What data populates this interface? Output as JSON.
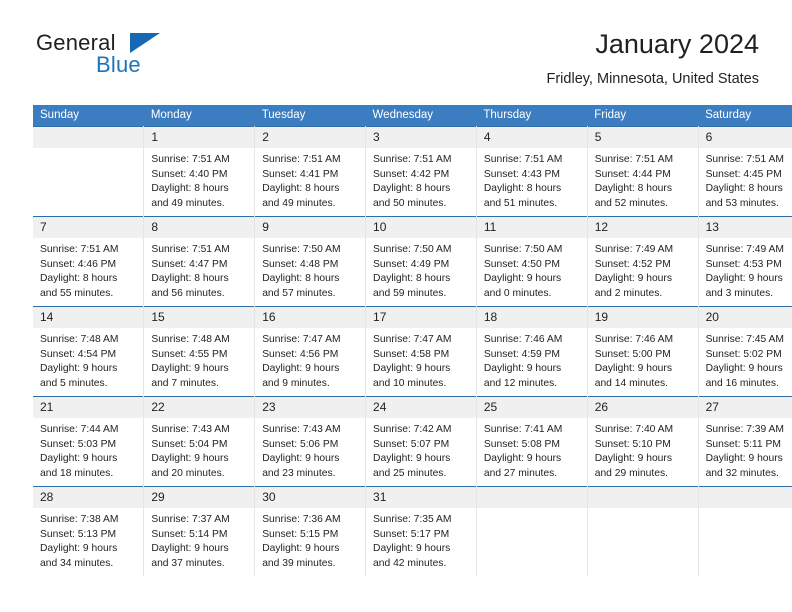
{
  "brand": {
    "name_part1": "General",
    "name_part2": "Blue",
    "triangle_icon": "triangle-icon",
    "accent_color": "#1b75bb"
  },
  "header": {
    "title": "January 2024",
    "subtitle": "Fridley, Minnesota, United States"
  },
  "colors": {
    "header_blue": "#3b7dc0",
    "row_divider": "#2f6ca8",
    "daynum_band": "#f0f0f0",
    "text": "#231f20"
  },
  "weekday_headers": [
    "Sunday",
    "Monday",
    "Tuesday",
    "Wednesday",
    "Thursday",
    "Friday",
    "Saturday"
  ],
  "weeks": [
    [
      {
        "day": "",
        "sunrise": "",
        "sunset": "",
        "daylight_line1": "",
        "daylight_line2": "",
        "empty": true
      },
      {
        "day": "1",
        "sunrise": "Sunrise: 7:51 AM",
        "sunset": "Sunset: 4:40 PM",
        "daylight_line1": "Daylight: 8 hours",
        "daylight_line2": "and 49 minutes."
      },
      {
        "day": "2",
        "sunrise": "Sunrise: 7:51 AM",
        "sunset": "Sunset: 4:41 PM",
        "daylight_line1": "Daylight: 8 hours",
        "daylight_line2": "and 49 minutes."
      },
      {
        "day": "3",
        "sunrise": "Sunrise: 7:51 AM",
        "sunset": "Sunset: 4:42 PM",
        "daylight_line1": "Daylight: 8 hours",
        "daylight_line2": "and 50 minutes."
      },
      {
        "day": "4",
        "sunrise": "Sunrise: 7:51 AM",
        "sunset": "Sunset: 4:43 PM",
        "daylight_line1": "Daylight: 8 hours",
        "daylight_line2": "and 51 minutes."
      },
      {
        "day": "5",
        "sunrise": "Sunrise: 7:51 AM",
        "sunset": "Sunset: 4:44 PM",
        "daylight_line1": "Daylight: 8 hours",
        "daylight_line2": "and 52 minutes."
      },
      {
        "day": "6",
        "sunrise": "Sunrise: 7:51 AM",
        "sunset": "Sunset: 4:45 PM",
        "daylight_line1": "Daylight: 8 hours",
        "daylight_line2": "and 53 minutes."
      }
    ],
    [
      {
        "day": "7",
        "sunrise": "Sunrise: 7:51 AM",
        "sunset": "Sunset: 4:46 PM",
        "daylight_line1": "Daylight: 8 hours",
        "daylight_line2": "and 55 minutes."
      },
      {
        "day": "8",
        "sunrise": "Sunrise: 7:51 AM",
        "sunset": "Sunset: 4:47 PM",
        "daylight_line1": "Daylight: 8 hours",
        "daylight_line2": "and 56 minutes."
      },
      {
        "day": "9",
        "sunrise": "Sunrise: 7:50 AM",
        "sunset": "Sunset: 4:48 PM",
        "daylight_line1": "Daylight: 8 hours",
        "daylight_line2": "and 57 minutes."
      },
      {
        "day": "10",
        "sunrise": "Sunrise: 7:50 AM",
        "sunset": "Sunset: 4:49 PM",
        "daylight_line1": "Daylight: 8 hours",
        "daylight_line2": "and 59 minutes."
      },
      {
        "day": "11",
        "sunrise": "Sunrise: 7:50 AM",
        "sunset": "Sunset: 4:50 PM",
        "daylight_line1": "Daylight: 9 hours",
        "daylight_line2": "and 0 minutes."
      },
      {
        "day": "12",
        "sunrise": "Sunrise: 7:49 AM",
        "sunset": "Sunset: 4:52 PM",
        "daylight_line1": "Daylight: 9 hours",
        "daylight_line2": "and 2 minutes."
      },
      {
        "day": "13",
        "sunrise": "Sunrise: 7:49 AM",
        "sunset": "Sunset: 4:53 PM",
        "daylight_line1": "Daylight: 9 hours",
        "daylight_line2": "and 3 minutes."
      }
    ],
    [
      {
        "day": "14",
        "sunrise": "Sunrise: 7:48 AM",
        "sunset": "Sunset: 4:54 PM",
        "daylight_line1": "Daylight: 9 hours",
        "daylight_line2": "and 5 minutes."
      },
      {
        "day": "15",
        "sunrise": "Sunrise: 7:48 AM",
        "sunset": "Sunset: 4:55 PM",
        "daylight_line1": "Daylight: 9 hours",
        "daylight_line2": "and 7 minutes."
      },
      {
        "day": "16",
        "sunrise": "Sunrise: 7:47 AM",
        "sunset": "Sunset: 4:56 PM",
        "daylight_line1": "Daylight: 9 hours",
        "daylight_line2": "and 9 minutes."
      },
      {
        "day": "17",
        "sunrise": "Sunrise: 7:47 AM",
        "sunset": "Sunset: 4:58 PM",
        "daylight_line1": "Daylight: 9 hours",
        "daylight_line2": "and 10 minutes."
      },
      {
        "day": "18",
        "sunrise": "Sunrise: 7:46 AM",
        "sunset": "Sunset: 4:59 PM",
        "daylight_line1": "Daylight: 9 hours",
        "daylight_line2": "and 12 minutes."
      },
      {
        "day": "19",
        "sunrise": "Sunrise: 7:46 AM",
        "sunset": "Sunset: 5:00 PM",
        "daylight_line1": "Daylight: 9 hours",
        "daylight_line2": "and 14 minutes."
      },
      {
        "day": "20",
        "sunrise": "Sunrise: 7:45 AM",
        "sunset": "Sunset: 5:02 PM",
        "daylight_line1": "Daylight: 9 hours",
        "daylight_line2": "and 16 minutes."
      }
    ],
    [
      {
        "day": "21",
        "sunrise": "Sunrise: 7:44 AM",
        "sunset": "Sunset: 5:03 PM",
        "daylight_line1": "Daylight: 9 hours",
        "daylight_line2": "and 18 minutes."
      },
      {
        "day": "22",
        "sunrise": "Sunrise: 7:43 AM",
        "sunset": "Sunset: 5:04 PM",
        "daylight_line1": "Daylight: 9 hours",
        "daylight_line2": "and 20 minutes."
      },
      {
        "day": "23",
        "sunrise": "Sunrise: 7:43 AM",
        "sunset": "Sunset: 5:06 PM",
        "daylight_line1": "Daylight: 9 hours",
        "daylight_line2": "and 23 minutes."
      },
      {
        "day": "24",
        "sunrise": "Sunrise: 7:42 AM",
        "sunset": "Sunset: 5:07 PM",
        "daylight_line1": "Daylight: 9 hours",
        "daylight_line2": "and 25 minutes."
      },
      {
        "day": "25",
        "sunrise": "Sunrise: 7:41 AM",
        "sunset": "Sunset: 5:08 PM",
        "daylight_line1": "Daylight: 9 hours",
        "daylight_line2": "and 27 minutes."
      },
      {
        "day": "26",
        "sunrise": "Sunrise: 7:40 AM",
        "sunset": "Sunset: 5:10 PM",
        "daylight_line1": "Daylight: 9 hours",
        "daylight_line2": "and 29 minutes."
      },
      {
        "day": "27",
        "sunrise": "Sunrise: 7:39 AM",
        "sunset": "Sunset: 5:11 PM",
        "daylight_line1": "Daylight: 9 hours",
        "daylight_line2": "and 32 minutes."
      }
    ],
    [
      {
        "day": "28",
        "sunrise": "Sunrise: 7:38 AM",
        "sunset": "Sunset: 5:13 PM",
        "daylight_line1": "Daylight: 9 hours",
        "daylight_line2": "and 34 minutes."
      },
      {
        "day": "29",
        "sunrise": "Sunrise: 7:37 AM",
        "sunset": "Sunset: 5:14 PM",
        "daylight_line1": "Daylight: 9 hours",
        "daylight_line2": "and 37 minutes."
      },
      {
        "day": "30",
        "sunrise": "Sunrise: 7:36 AM",
        "sunset": "Sunset: 5:15 PM",
        "daylight_line1": "Daylight: 9 hours",
        "daylight_line2": "and 39 minutes."
      },
      {
        "day": "31",
        "sunrise": "Sunrise: 7:35 AM",
        "sunset": "Sunset: 5:17 PM",
        "daylight_line1": "Daylight: 9 hours",
        "daylight_line2": "and 42 minutes."
      },
      {
        "day": "",
        "sunrise": "",
        "sunset": "",
        "daylight_line1": "",
        "daylight_line2": "",
        "empty": true
      },
      {
        "day": "",
        "sunrise": "",
        "sunset": "",
        "daylight_line1": "",
        "daylight_line2": "",
        "empty": true
      },
      {
        "day": "",
        "sunrise": "",
        "sunset": "",
        "daylight_line1": "",
        "daylight_line2": "",
        "empty": true
      }
    ]
  ]
}
